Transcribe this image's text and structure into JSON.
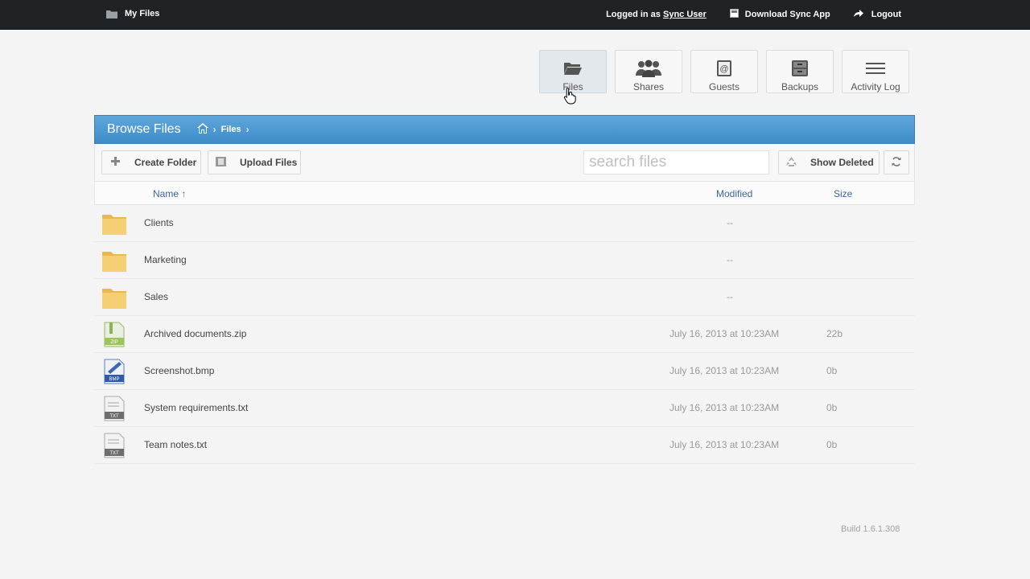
{
  "topbar": {
    "brand_icon": "folder-icon",
    "brand_label": "My Files",
    "login_prefix": "Logged in as",
    "login_user": "Sync User",
    "download_label": "Download Sync App",
    "logout_label": "Logout"
  },
  "nav": {
    "tiles": [
      {
        "label": "Files",
        "icon": "folder-open-icon",
        "active": true
      },
      {
        "label": "Shares",
        "icon": "users-icon",
        "active": false
      },
      {
        "label": "Guests",
        "icon": "contact-book-icon",
        "active": false
      },
      {
        "label": "Backups",
        "icon": "archive-box-icon",
        "active": false
      },
      {
        "label": "Activity Log",
        "icon": "list-icon",
        "active": false
      }
    ]
  },
  "panel": {
    "title": "Browse Files",
    "breadcrumb": {
      "home_icon": "home-icon",
      "current": "Files"
    }
  },
  "toolbar": {
    "create_folder_label": "Create Folder",
    "upload_files_label": "Upload Files",
    "search_placeholder": "search files",
    "show_deleted_label": "Show Deleted"
  },
  "columns": {
    "name": "Name ↑",
    "modified": "Modified",
    "size": "Size"
  },
  "files": [
    {
      "name": "Clients",
      "type": "folder",
      "modified": "--",
      "size": ""
    },
    {
      "name": "Marketing",
      "type": "folder",
      "modified": "--",
      "size": ""
    },
    {
      "name": "Sales",
      "type": "folder",
      "modified": "--",
      "size": ""
    },
    {
      "name": "Archived documents.zip",
      "type": "zip",
      "badge": "ZIP",
      "modified": "July 16, 2013 at 10:23AM",
      "size": "22b"
    },
    {
      "name": "Screenshot.bmp",
      "type": "bmp",
      "badge": "BMP",
      "modified": "July 16, 2013 at 10:23AM",
      "size": "0b"
    },
    {
      "name": "System requirements.txt",
      "type": "txt",
      "badge": "TXT",
      "modified": "July 16, 2013 at 10:23AM",
      "size": "0b"
    },
    {
      "name": "Team notes.txt",
      "type": "txt",
      "badge": "TXT",
      "modified": "July 16, 2013 at 10:23AM",
      "size": "0b"
    }
  ],
  "footer": {
    "build": "Build 1.6.1.308"
  },
  "colors": {
    "header_blue": "#4796d0",
    "link_blue": "#3a63a8",
    "folder_yellow": "#f6cf74"
  }
}
